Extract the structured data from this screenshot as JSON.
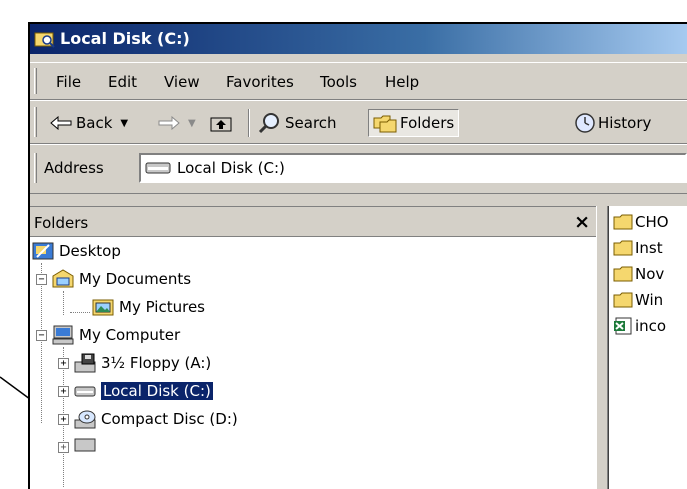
{
  "window": {
    "title": "Local Disk (C:)"
  },
  "menu": [
    {
      "label": "File"
    },
    {
      "label": "Edit"
    },
    {
      "label": "View"
    },
    {
      "label": "Favorites"
    },
    {
      "label": "Tools"
    },
    {
      "label": "Help"
    }
  ],
  "toolbar": {
    "back_label": "Back",
    "search_label": "Search",
    "folders_label": "Folders",
    "history_label": "History"
  },
  "address": {
    "label": "Address",
    "value": "Local Disk (C:)"
  },
  "folders_pane": {
    "title": "Folders",
    "close_glyph": "×",
    "tree": [
      {
        "label": "Desktop",
        "icon": "desktop-icon"
      },
      {
        "label": "My Documents",
        "icon": "my-documents-icon",
        "expander": "−"
      },
      {
        "label": "My Pictures",
        "icon": "my-pictures-icon"
      },
      {
        "label": "My Computer",
        "icon": "my-computer-icon",
        "expander": "−"
      },
      {
        "label": "3½ Floppy (A:)",
        "icon": "floppy-drive-icon",
        "expander": "+"
      },
      {
        "label": "Local Disk (C:)",
        "icon": "hard-drive-icon",
        "expander": "+",
        "selected": true
      },
      {
        "label": "Compact Disc (D:)",
        "icon": "cd-drive-icon",
        "expander": "+"
      }
    ]
  },
  "files": [
    {
      "label": "CHO",
      "icon": "folder-icon"
    },
    {
      "label": "Inst",
      "icon": "folder-icon"
    },
    {
      "label": "Nov",
      "icon": "folder-icon"
    },
    {
      "label": "Win",
      "icon": "folder-icon"
    },
    {
      "label": "inco",
      "icon": "excel-file-icon"
    }
  ],
  "colors": {
    "selection": "#0a246a",
    "titlebar_start": "#0a246a",
    "titlebar_end": "#a6caf0",
    "chrome": "#d4d0c8"
  }
}
